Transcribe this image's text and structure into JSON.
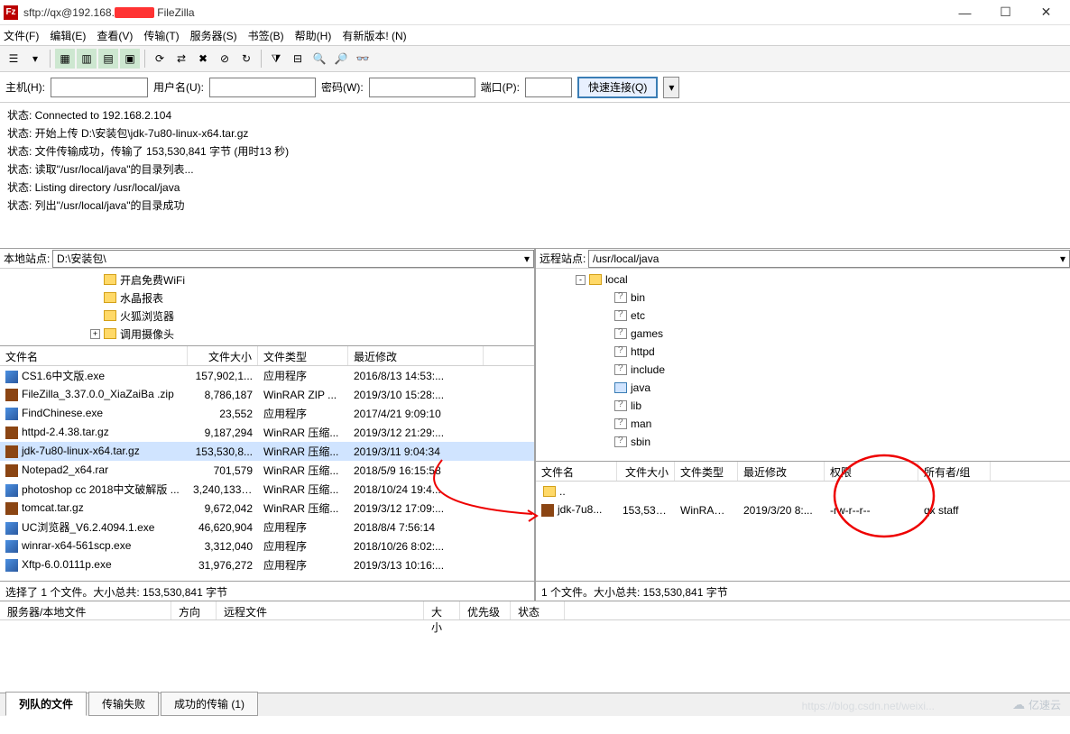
{
  "title": {
    "prefix": "sftp://qx@192.168.",
    "suffix": " FileZilla"
  },
  "window_controls": {
    "min": "—",
    "max": "☐",
    "close": "✕"
  },
  "menu": [
    "文件(F)",
    "编辑(E)",
    "查看(V)",
    "传输(T)",
    "服务器(S)",
    "书签(B)",
    "帮助(H)",
    "有新版本! (N)"
  ],
  "quickconnect": {
    "host_label": "主机(H):",
    "user_label": "用户名(U):",
    "pass_label": "密码(W):",
    "port_label": "端口(P):",
    "connect_btn": "快速连接(Q)",
    "dropdown": "▾",
    "host": "",
    "user": "",
    "pass": "",
    "port": ""
  },
  "log": [
    "状态: Connected to 192.168.2.104",
    "状态: 开始上传 D:\\安装包\\jdk-7u80-linux-x64.tar.gz",
    "状态: 文件传输成功，传输了 153,530,841 字节 (用时13 秒)",
    "状态: 读取\"/usr/local/java\"的目录列表...",
    "状态: Listing directory /usr/local/java",
    "状态: 列出\"/usr/local/java\"的目录成功"
  ],
  "local": {
    "site_label": "本地站点:",
    "path": "D:\\安装包\\",
    "tree": [
      {
        "indent": 100,
        "label": "开启免费WiFi",
        "toggle": ""
      },
      {
        "indent": 100,
        "label": "水晶报表",
        "toggle": ""
      },
      {
        "indent": 100,
        "label": "火狐浏览器",
        "toggle": ""
      },
      {
        "indent": 100,
        "label": "调用摄像头",
        "toggle": "+"
      }
    ],
    "headers": {
      "name": "文件名",
      "size": "文件大小",
      "type": "文件类型",
      "date": "最近修改"
    },
    "files": [
      {
        "icon": "fc-exe",
        "name": "CS1.6中文版.exe",
        "size": "157,902,1...",
        "type": "应用程序",
        "date": "2016/8/13 14:53:..."
      },
      {
        "icon": "fc-zip",
        "name": "FileZilla_3.37.0.0_XiaZaiBa .zip",
        "size": "8,786,187",
        "type": "WinRAR ZIP ...",
        "date": "2019/3/10 15:28:..."
      },
      {
        "icon": "fc-exe",
        "name": "FindChinese.exe",
        "size": "23,552",
        "type": "应用程序",
        "date": "2017/4/21 9:09:10"
      },
      {
        "icon": "fc-zip",
        "name": "httpd-2.4.38.tar.gz",
        "size": "9,187,294",
        "type": "WinRAR 压缩...",
        "date": "2019/3/12 21:29:..."
      },
      {
        "icon": "fc-zip",
        "name": "jdk-7u80-linux-x64.tar.gz",
        "size": "153,530,8...",
        "type": "WinRAR 压缩...",
        "date": "2019/3/11 9:04:34",
        "selected": true
      },
      {
        "icon": "fc-zip",
        "name": "Notepad2_x64.rar",
        "size": "701,579",
        "type": "WinRAR 压缩...",
        "date": "2018/5/9 16:15:58"
      },
      {
        "icon": "fc-exe",
        "name": "photoshop cc 2018中文破解版 ...",
        "size": "3,240,133,...",
        "type": "WinRAR 压缩...",
        "date": "2018/10/24 19:4..."
      },
      {
        "icon": "fc-zip",
        "name": "tomcat.tar.gz",
        "size": "9,672,042",
        "type": "WinRAR 压缩...",
        "date": "2019/3/12 17:09:..."
      },
      {
        "icon": "fc-exe",
        "name": "UC浏览器_V6.2.4094.1.exe",
        "size": "46,620,904",
        "type": "应用程序",
        "date": "2018/8/4 7:56:14"
      },
      {
        "icon": "fc-exe",
        "name": "winrar-x64-561scp.exe",
        "size": "3,312,040",
        "type": "应用程序",
        "date": "2018/10/26 8:02:..."
      },
      {
        "icon": "fc-exe",
        "name": "Xftp-6.0.0111p.exe",
        "size": "31,976,272",
        "type": "应用程序",
        "date": "2019/3/13 10:16:..."
      }
    ],
    "status": "选择了 1 个文件。大小总共: 153,530,841 字节"
  },
  "remote": {
    "site_label": "远程站点:",
    "path": "/usr/local/java",
    "tree": [
      {
        "indent": 44,
        "label": "local",
        "toggle": "-",
        "cls": ""
      },
      {
        "indent": 72,
        "label": "bin",
        "toggle": "",
        "cls": "q"
      },
      {
        "indent": 72,
        "label": "etc",
        "toggle": "",
        "cls": "q"
      },
      {
        "indent": 72,
        "label": "games",
        "toggle": "",
        "cls": "q"
      },
      {
        "indent": 72,
        "label": "httpd",
        "toggle": "",
        "cls": "q"
      },
      {
        "indent": 72,
        "label": "include",
        "toggle": "",
        "cls": "q"
      },
      {
        "indent": 72,
        "label": "java",
        "toggle": "",
        "cls": "sel"
      },
      {
        "indent": 72,
        "label": "lib",
        "toggle": "",
        "cls": "q"
      },
      {
        "indent": 72,
        "label": "man",
        "toggle": "",
        "cls": "q"
      },
      {
        "indent": 72,
        "label": "sbin",
        "toggle": "",
        "cls": "q"
      }
    ],
    "headers": {
      "name": "文件名",
      "size": "文件大小",
      "type": "文件类型",
      "date": "最近修改",
      "perm": "权限",
      "owner": "所有者/组"
    },
    "files": [
      {
        "icon": "folder-icon",
        "name": "..",
        "size": "",
        "type": "",
        "date": "",
        "perm": "",
        "owner": ""
      },
      {
        "icon": "fc-zip",
        "name": "jdk-7u8...",
        "size": "153,530,...",
        "type": "WinRAR ...",
        "date": "2019/3/20 8:...",
        "perm": "-rw-r--r--",
        "owner": "qx staff"
      }
    ],
    "status": "1 个文件。大小总共: 153,530,841 字节"
  },
  "queue": {
    "headers": [
      "服务器/本地文件",
      "方向",
      "远程文件",
      "大小",
      "优先级",
      "状态"
    ]
  },
  "tabs": {
    "queued": "列队的文件",
    "failed": "传输失败",
    "success": "成功的传输 (1)"
  },
  "watermark": "亿速云",
  "watermark2": "https://blog.csdn.net/weixi..."
}
